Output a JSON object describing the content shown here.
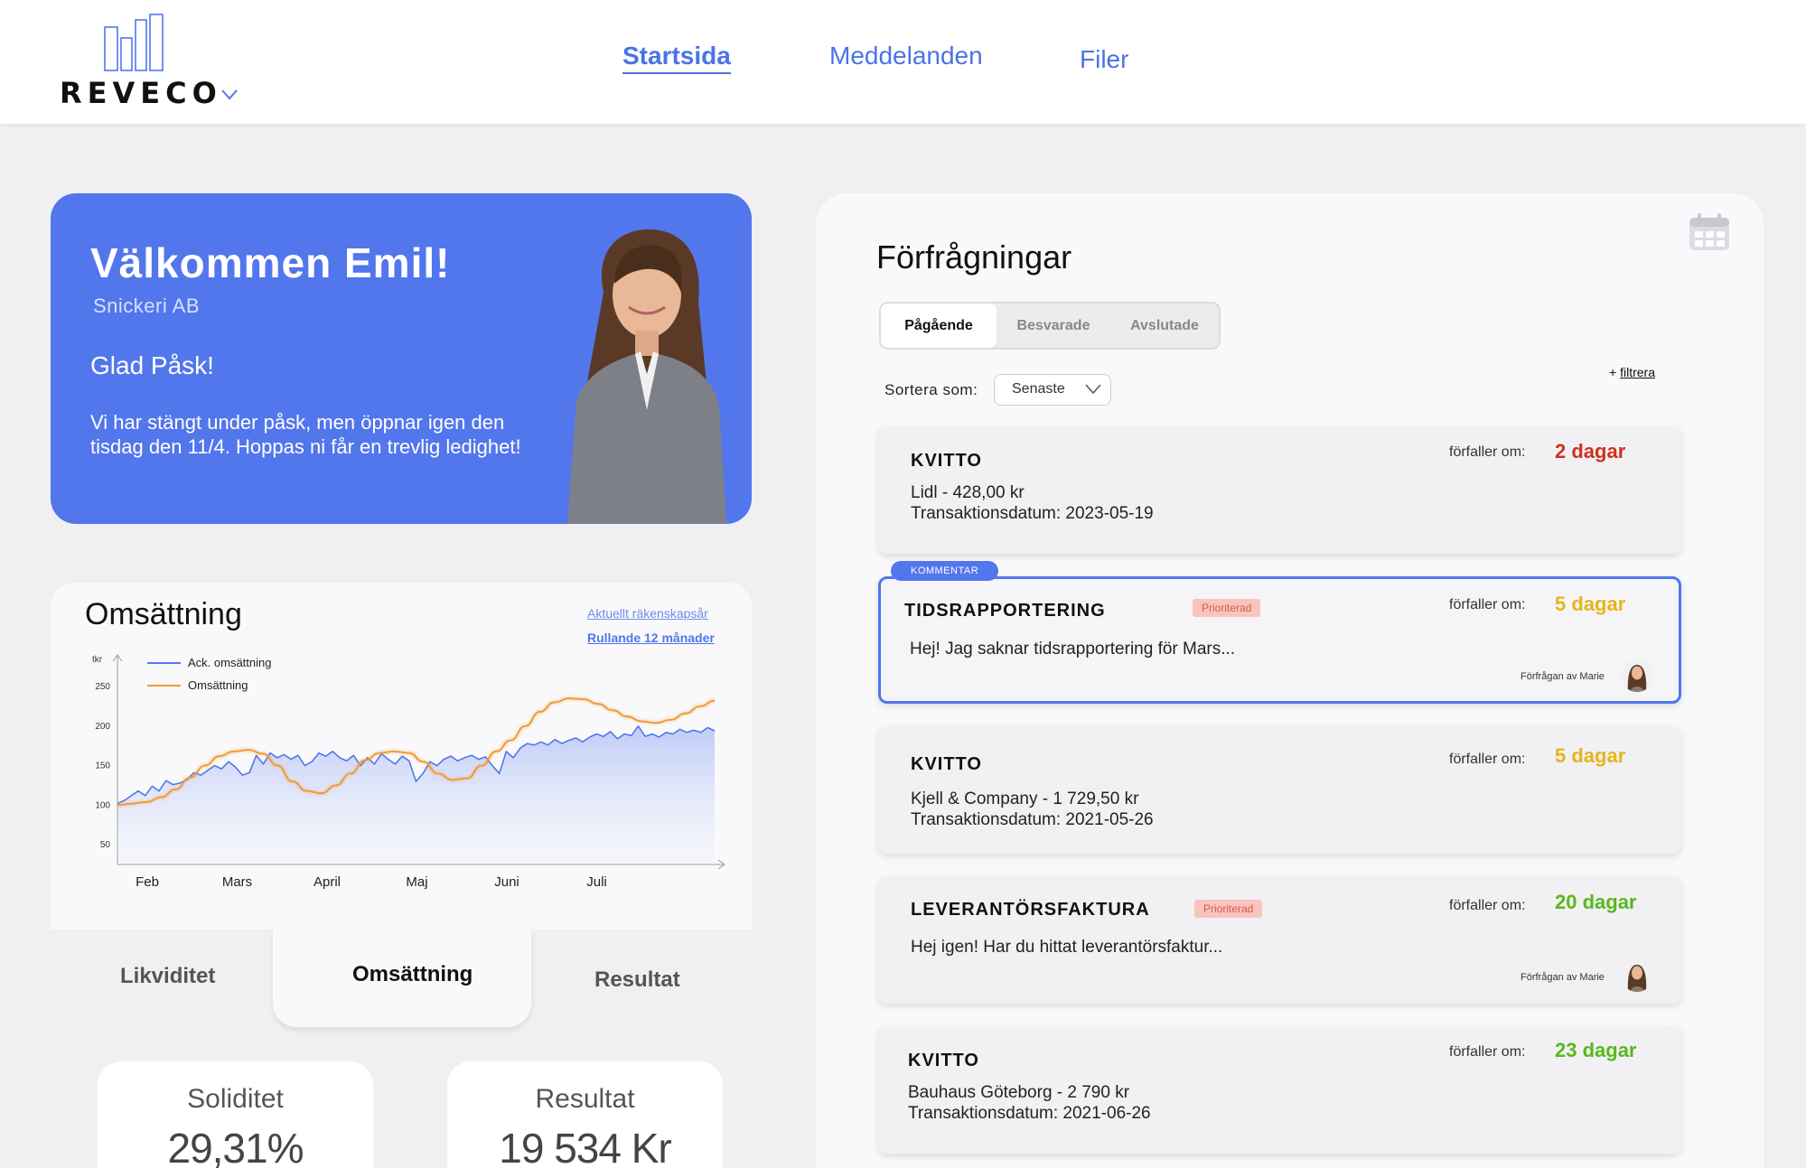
{
  "header": {
    "logo_text": "REVECO",
    "nav": [
      {
        "label": "Startsida",
        "active": true
      },
      {
        "label": "Meddelanden",
        "active": false
      },
      {
        "label": "Filer",
        "active": false
      }
    ]
  },
  "welcome": {
    "title": "Välkommen Emil!",
    "company": "Snickeri AB",
    "greeting": "Glad Påsk!",
    "message": "Vi har stängt under påsk, men öppnar igen den tisdag den 11/4.  Hoppas ni får en trevlig ledighet!"
  },
  "revenue": {
    "title": "Omsättning",
    "link_fiscal": "Aktuellt räkenskapsår",
    "link_rolling": "Rullande 12 månader"
  },
  "chart_data": {
    "type": "line",
    "ylabel": "tkr",
    "yticks": [
      50,
      100,
      150,
      200,
      250
    ],
    "ylim": [
      25,
      290
    ],
    "xticks": [
      "Feb",
      "Mars",
      "April",
      "Maj",
      "Juni",
      "Juli"
    ],
    "legend_position": "top-left",
    "series": [
      {
        "name": "Ack. omsättning",
        "color": "#5276ec",
        "fill": true,
        "values": [
          102,
          106,
          112,
          118,
          112,
          124,
          118,
          131,
          126,
          128,
          132,
          141,
          138,
          144,
          150,
          146,
          155,
          148,
          138,
          141,
          163,
          152,
          166,
          160,
          164,
          158,
          163,
          150,
          155,
          166,
          162,
          168,
          160,
          156,
          163,
          150,
          160,
          152,
          165,
          158,
          152,
          162,
          156,
          130,
          140,
          155,
          150,
          158,
          162,
          156,
          160,
          163,
          158,
          161,
          150,
          140,
          168,
          160,
          172,
          178,
          176,
          180,
          176,
          183,
          178,
          182,
          185,
          180,
          186,
          190,
          187,
          193,
          184,
          190,
          188,
          200,
          187,
          190,
          186,
          192,
          190,
          196,
          192,
          195,
          192,
          198,
          194
        ]
      },
      {
        "name": "Omsättning",
        "color": "#f29a33",
        "fill": false,
        "values": [
          100,
          102,
          104,
          110,
          120,
          135,
          150,
          162,
          168,
          170,
          165,
          150,
          130,
          118,
          115,
          125,
          140,
          157,
          166,
          168,
          166,
          155,
          140,
          132,
          134,
          150,
          168,
          182,
          200,
          218,
          230,
          235,
          234,
          228,
          220,
          212,
          206,
          204,
          208,
          216,
          225,
          232
        ]
      }
    ]
  },
  "tabs": [
    {
      "label": "Likviditet",
      "active": false
    },
    {
      "label": "Omsättning",
      "active": true
    },
    {
      "label": "Resultat",
      "active": false
    }
  ],
  "kpis": [
    {
      "label": "Soliditet",
      "value": "29,31%"
    },
    {
      "label": "Resultat",
      "value": "19 534 Kr"
    }
  ],
  "requests": {
    "title": "Förfrågningar",
    "segments": [
      {
        "label": "Pågående",
        "active": true
      },
      {
        "label": "Besvarade",
        "active": false
      },
      {
        "label": "Avslutade",
        "active": false
      }
    ],
    "sort_label": "Sortera som:",
    "sort_value": "Senaste",
    "filter_prefix": "+ ",
    "filter_label": "filtrera",
    "due_label": "förfaller om:",
    "items": [
      {
        "type": "KVITTO",
        "line1": "Lidl - 428,00 kr",
        "line2": "Transaktionsdatum: 2023-05-19",
        "due": "2 dagar",
        "due_color": "red"
      },
      {
        "type": "TIDSRAPPORTERING",
        "badge_comment": "KOMMENTAR",
        "badge_priority": "Prioriterad",
        "line1": "Hej! Jag saknar tidsrapportering för Mars...",
        "due": "5 dagar",
        "due_color": "yellow",
        "requested_by": "Förfrågan av Marie"
      },
      {
        "type": "KVITTO",
        "line1": "Kjell & Company - 1 729,50 kr",
        "line2": "Transaktionsdatum: 2021-05-26",
        "due": "5 dagar",
        "due_color": "yellow"
      },
      {
        "type": "LEVERANTÖRSFAKTURA",
        "badge_priority": "Prioriterad",
        "line1": "Hej igen! Har du hittat leverantörsfaktur...",
        "due": "20 dagar",
        "due_color": "green",
        "requested_by": "Förfrågan av Marie"
      },
      {
        "type": "KVITTO",
        "line1": "Bauhaus Göteborg - 2 790 kr",
        "line2": "Transaktionsdatum: 2021-06-26",
        "due": "23 dagar",
        "due_color": "green"
      }
    ]
  }
}
